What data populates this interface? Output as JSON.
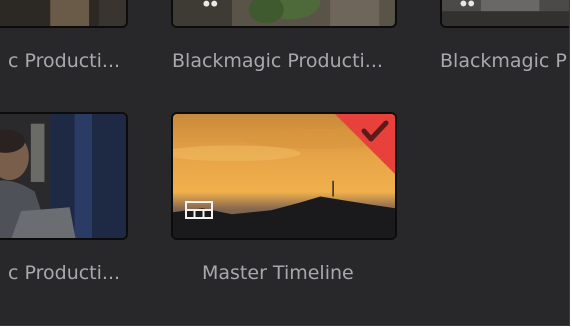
{
  "media_pool": {
    "clips": [
      {
        "name": "c Producti..."
      },
      {
        "name": "Blackmagic Producti..."
      },
      {
        "name": "Blackmagic P"
      },
      {
        "name": "c Producti..."
      },
      {
        "name": "Master Timeline",
        "selected": true
      }
    ]
  },
  "icons": {
    "timeline": "timeline-grid-icon",
    "selected": "checkmark-icon"
  },
  "colors": {
    "panel_bg": "#28282b",
    "label_text": "#a9a9ad",
    "selection_flag": "#e8403a",
    "checkmark": "#5a1c1a"
  }
}
